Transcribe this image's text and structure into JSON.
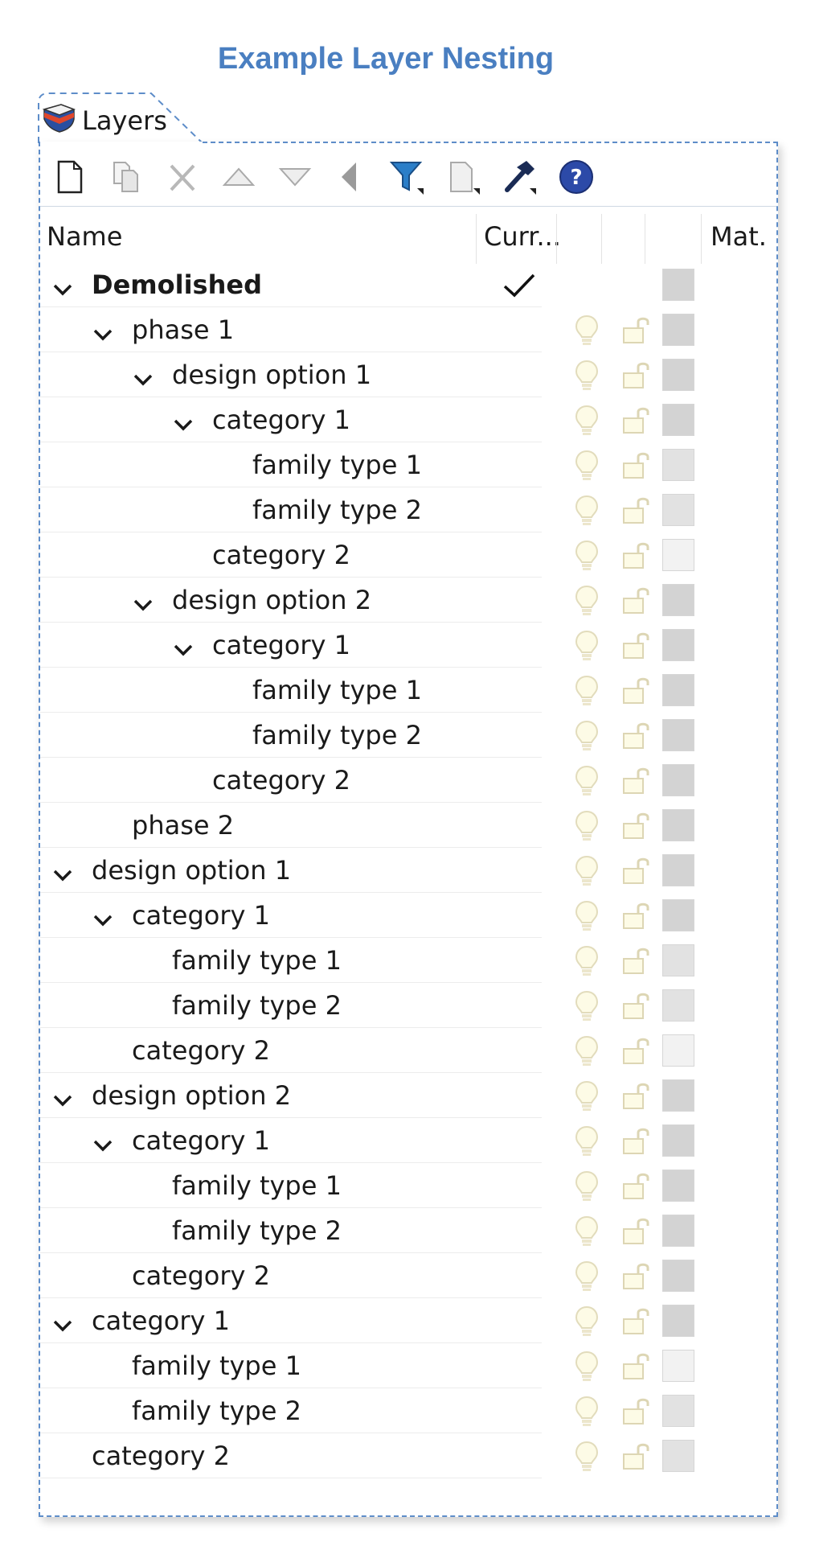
{
  "page": {
    "title": "Example Layer Nesting"
  },
  "panel": {
    "tab_label": "Layers",
    "toolbar": [
      "new-layer-icon",
      "copy-icon",
      "delete-icon",
      "move-up-icon",
      "move-down-icon",
      "move-to-parent-icon",
      "filter-icon",
      "tools-icon",
      "hammer-icon",
      "help-icon"
    ],
    "columns": {
      "name": "Name",
      "current": "Curr...",
      "material": "Mat."
    },
    "colors": {
      "accent": "#4a7fc1",
      "swatch_dark": "#d3d3d3",
      "swatch_mid": "#e2e2e2",
      "swatch_light": "#f2f2f2"
    }
  },
  "layers": [
    {
      "name": "Demolished",
      "level": 0,
      "expanded": true,
      "bold": true,
      "current": true,
      "swatch": "#d3d3d3"
    },
    {
      "name": "phase 1",
      "level": 1,
      "expanded": true,
      "swatch": "#d3d3d3"
    },
    {
      "name": "design option 1",
      "level": 2,
      "expanded": true,
      "swatch": "#d3d3d3"
    },
    {
      "name": "category 1",
      "level": 3,
      "expanded": true,
      "swatch": "#d3d3d3"
    },
    {
      "name": "family type 1",
      "level": 4,
      "swatch": "#e2e2e2"
    },
    {
      "name": "family type 2",
      "level": 4,
      "swatch": "#e2e2e2"
    },
    {
      "name": "category 2",
      "level": 3,
      "swatch": "#f2f2f2"
    },
    {
      "name": "design option 2",
      "level": 2,
      "expanded": true,
      "swatch": "#d3d3d3"
    },
    {
      "name": "category 1",
      "level": 3,
      "expanded": true,
      "swatch": "#d3d3d3"
    },
    {
      "name": "family type 1",
      "level": 4,
      "swatch": "#d3d3d3"
    },
    {
      "name": "family type 2",
      "level": 4,
      "swatch": "#d3d3d3"
    },
    {
      "name": "category 2",
      "level": 3,
      "swatch": "#d3d3d3"
    },
    {
      "name": "phase 2",
      "level": 1,
      "swatch": "#d3d3d3"
    },
    {
      "name": "design option 1",
      "level": 0,
      "expanded": true,
      "swatch": "#d3d3d3"
    },
    {
      "name": "category 1",
      "level": 1,
      "expanded": true,
      "swatch": "#d3d3d3"
    },
    {
      "name": "family type 1",
      "level": 2,
      "swatch": "#e2e2e2"
    },
    {
      "name": "family type 2",
      "level": 2,
      "swatch": "#e2e2e2"
    },
    {
      "name": "category 2",
      "level": 1,
      "swatch": "#f2f2f2"
    },
    {
      "name": "design option 2",
      "level": 0,
      "expanded": true,
      "swatch": "#d3d3d3"
    },
    {
      "name": "category 1",
      "level": 1,
      "expanded": true,
      "swatch": "#d3d3d3"
    },
    {
      "name": "family type 1",
      "level": 2,
      "swatch": "#d3d3d3"
    },
    {
      "name": "family type 2",
      "level": 2,
      "swatch": "#d3d3d3"
    },
    {
      "name": "category 2",
      "level": 1,
      "swatch": "#d3d3d3"
    },
    {
      "name": "category 1",
      "level": 0,
      "expanded": true,
      "swatch": "#d3d3d3"
    },
    {
      "name": "family type 1",
      "level": 1,
      "swatch": "#f2f2f2"
    },
    {
      "name": "family type 2",
      "level": 1,
      "swatch": "#e2e2e2"
    },
    {
      "name": "category 2",
      "level": 0,
      "swatch": "#e2e2e2"
    }
  ]
}
